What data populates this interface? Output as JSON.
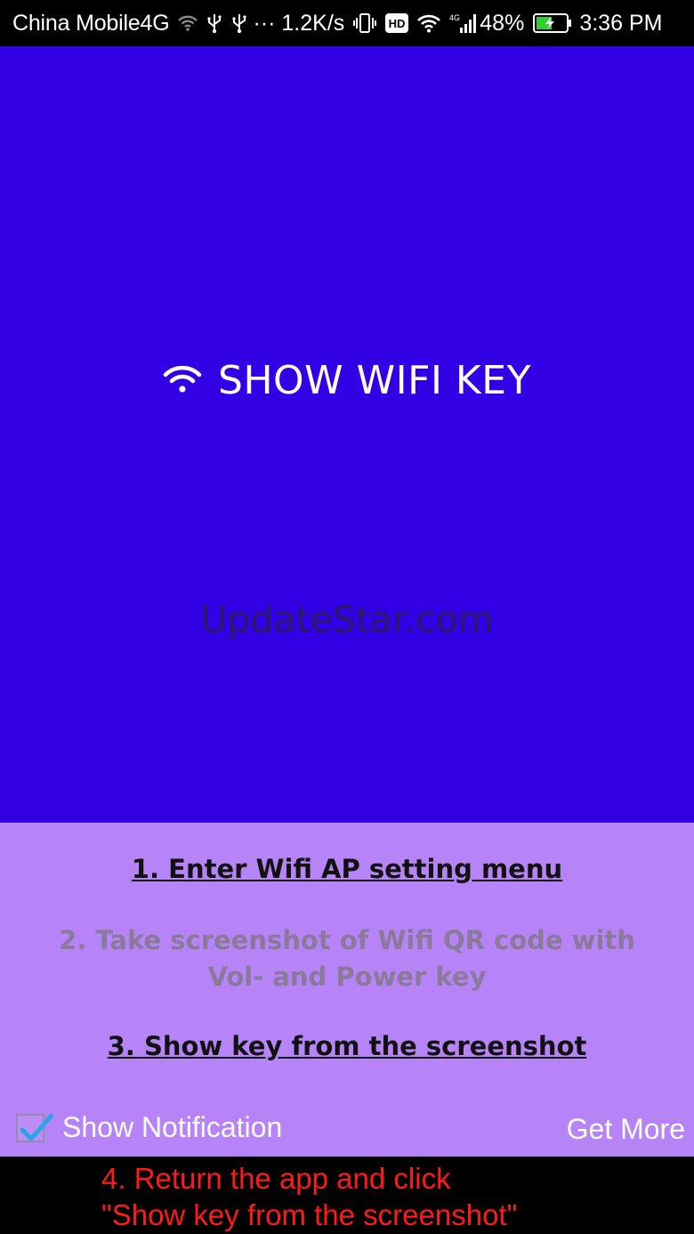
{
  "status_bar": {
    "carrier": "China Mobile4G",
    "speed": "··· 1.2K/s",
    "hd": "HD",
    "network": "4G",
    "battery": "48%",
    "time": "3:36 PM",
    "icons": [
      "wifi-icon",
      "usb-icon",
      "usb-icon",
      "vibrate-icon",
      "hd-icon",
      "wifi-icon",
      "signal-icon",
      "battery-icon"
    ]
  },
  "main": {
    "title": "SHOW WIFI KEY",
    "watermark": "UpdateStar.com",
    "background": "#3300e6"
  },
  "panel": {
    "step1": "1. Enter Wifi AP setting menu",
    "step2_line1": "2. Take screenshot of Wifi QR code with",
    "step2_line2": "Vol- and Power key",
    "step3": "3. Show key from the screenshot",
    "show_notification": "Show Notification",
    "show_notification_checked": true,
    "get_more": "Get More",
    "background": "#b784f7"
  },
  "hint": {
    "line1": "4. Return the app and click",
    "line2": "\"Show key from the screenshot\"",
    "color": "#ff1a1a"
  }
}
